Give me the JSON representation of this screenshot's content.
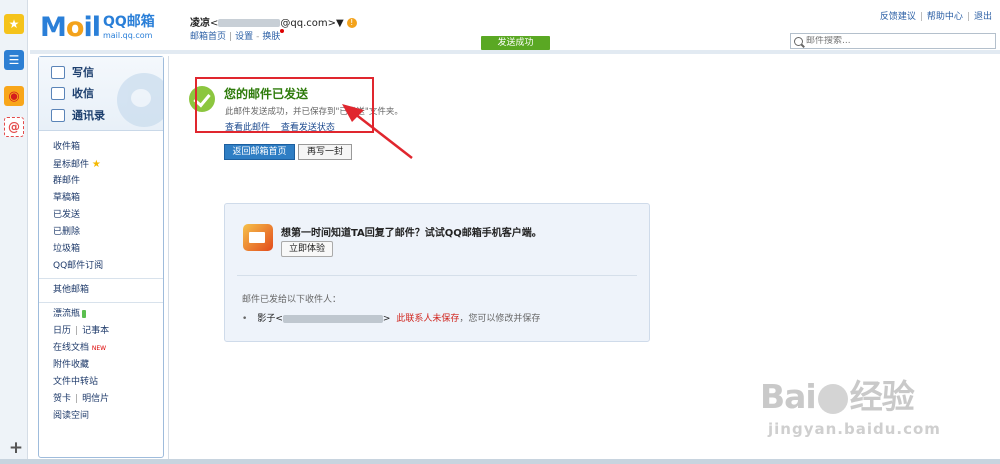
{
  "app": {
    "logo_main": "M",
    "logo_o": "o",
    "logo_tail": "il",
    "logo_brand": "QQ邮箱",
    "logo_url": "mail.qq.com"
  },
  "header": {
    "user_name": "凌凉",
    "user_email_prefix": "<",
    "user_email_suffix": "@qq.com>▼",
    "warn_glyph": "!",
    "links": [
      "邮箱首页",
      "设置",
      "换肤"
    ],
    "top_links": [
      "反馈建议",
      "帮助中心",
      "退出"
    ],
    "search_placeholder": "邮件搜索...",
    "toast": "发送成功"
  },
  "rail": {
    "icons": [
      "star-icon",
      "list-icon",
      "weibo-icon",
      "at-icon",
      "plus-icon"
    ],
    "plus": "+"
  },
  "sidebar": {
    "primary": [
      "写信",
      "收信",
      "通讯录"
    ],
    "folders": [
      "收件箱",
      "星标邮件",
      "群邮件",
      "草稿箱",
      "已发送",
      "已删除",
      "垃圾箱",
      "QQ邮件订阅"
    ],
    "other": "其他邮箱",
    "apps": {
      "bottle": "漂流瓶",
      "calendar": "日历",
      "notes": "记事本",
      "docs": "在线文档",
      "docs_badge": "NEW",
      "attachments": "附件收藏",
      "transfer": "文件中转站",
      "cards": "贺卡",
      "postcard": "明信片",
      "reading": "阅读空间"
    }
  },
  "main": {
    "title": "您的邮件已发送",
    "subtitle": "此邮件发送成功，并已保存到\"已发送\"文件夹。",
    "link_view": "查看此邮件",
    "link_status": "查看发送状态",
    "btn_home": "返回邮箱首页",
    "btn_again": "再写一封",
    "panel": {
      "promo": "想第一时间知道TA回复了邮件？试试QQ邮箱手机客户端。",
      "try_btn": "立即体验",
      "sent_to": "邮件已发给以下收件人：",
      "recipient_name": "影子<",
      "recipient_end": ">",
      "not_saved": "此联系人未保存",
      "hint": "，您可以修改并保存"
    }
  },
  "watermark": {
    "brand_a": "Bai",
    "brand_b": "经验",
    "url": "jingyan.baidu.com"
  },
  "colors": {
    "accent": "#2a7fd8",
    "success": "#2e7b0b",
    "toast": "#5aa823",
    "annotation": "#e0262e"
  }
}
